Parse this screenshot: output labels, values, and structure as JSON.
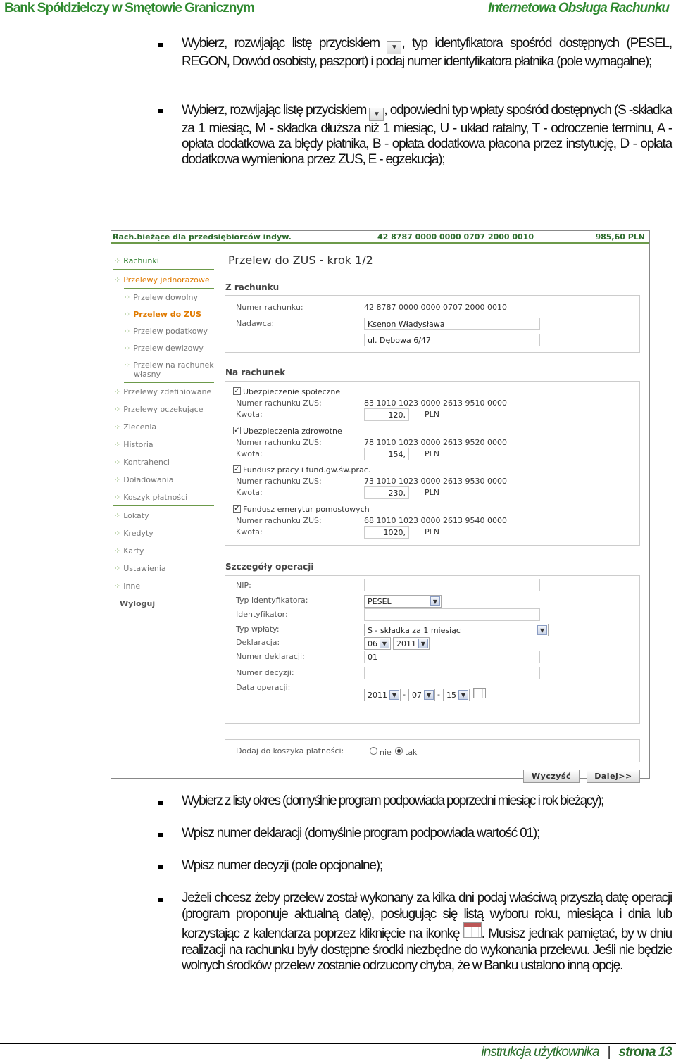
{
  "header": {
    "left": "Bank Spółdzielczy w Smętowie Granicznym",
    "right": "Internetowa Obsługa Rachunku"
  },
  "para1": {
    "a": "Wybierz, rozwijając listę przyciskiem",
    "b": ", typ identyfikatora spośród dostępnych (PESEL, REGON, Dowód osobisty, paszport) i podaj numer identyfikatora płatnika (pole wymagalne);"
  },
  "para2": {
    "a": "Wybierz, rozwijając listę przyciskiem",
    "b": ", odpowiedni typ wpłaty spośród dostępnych (S -składka za 1 miesiąc, M - składka dłuższa niż 1 miesiąc, U - układ ratalny, T - odroczenie terminu, A - opłata dodatkowa za błędy płatnika, B - opłata dodatkowa płacona przez instytucję, D - opłata dodatkowa wymieniona przez ZUS, E - egzekucja);"
  },
  "screen": {
    "topbar": {
      "account_name": "Rach.bieżące dla przedsiębiorców indyw.",
      "account_no": "42 8787 0000 0000 0707 2000 0010",
      "balance": "985,60 PLN"
    },
    "nav": {
      "rachunki": "Rachunki",
      "przelewy_jedn": "Przelewy jednorazowe",
      "dowolny": "Przelew dowolny",
      "zus": "Przelew do ZUS",
      "podatkowy": "Przelew podatkowy",
      "dewizowy": "Przelew dewizowy",
      "wlasny1": "Przelew na rachunek",
      "wlasny2": "własny",
      "zdefiniowane": "Przelewy zdefiniowane",
      "oczekujace": "Przelewy oczekujące",
      "zlecenia": "Zlecenia",
      "historia": "Historia",
      "kontrahenci": "Kontrahenci",
      "doladowania": "Doładowania",
      "koszyk": "Koszyk płatności",
      "lokaty": "Lokaty",
      "kredyty": "Kredyty",
      "karty": "Karty",
      "ustawienia": "Ustawienia",
      "inne": "Inne",
      "wyloguj": "Wyloguj"
    },
    "title": "Przelew do ZUS - krok 1/2",
    "from": {
      "section": "Z rachunku",
      "acc_label": "Numer rachunku:",
      "acc_value": "42 8787 0000 0000 0707 2000 0010",
      "sender_label": "Nadawca:",
      "sender_name": "Ksenon Władysława",
      "sender_addr": "ul. Dębowa 6/47"
    },
    "to": {
      "section": "Na rachunek",
      "acc_label": "Numer rachunku ZUS:",
      "amt_label": "Kwota:",
      "currency": "PLN",
      "items": [
        {
          "name": "Ubezpieczenie społeczne",
          "account": "83 1010 1023 0000 2613 9510 0000",
          "amount": "120,"
        },
        {
          "name": "Ubezpieczenia zdrowotne",
          "account": "78 1010 1023 0000 2613 9520 0000",
          "amount": "154,"
        },
        {
          "name": "Fundusz pracy i fund.gw.św.prac.",
          "account": "73 1010 1023 0000 2613 9530 0000",
          "amount": "230,"
        },
        {
          "name": "Fundusz emerytur pomostowych",
          "account": "68 1010 1023 0000 2613 9540 0000",
          "amount": "1020,"
        }
      ]
    },
    "details": {
      "section": "Szczegóły operacji",
      "nip": "NIP:",
      "id_type_label": "Typ identyfikatora:",
      "id_type": "PESEL",
      "id_label": "Identyfikator:",
      "pay_type_label": "Typ wpłaty:",
      "pay_type": "S - składka za 1 miesiąc",
      "decl_label": "Deklaracja:",
      "decl_month": "06",
      "decl_year": "2011",
      "decl_no_label": "Numer deklaracji:",
      "decl_no": "01",
      "decision_label": "Numer decyzji:",
      "date_label": "Data operacji:",
      "date_year": "2011",
      "date_month": "07",
      "date_day": "15",
      "dash": "-"
    },
    "basket": {
      "label": "Dodaj do koszyka płatności:",
      "no": "nie",
      "yes": "tak"
    },
    "buttons": {
      "clear": "Wyczyść",
      "next": "Dalej>>"
    }
  },
  "bullets": {
    "b1": "Wybierz z listy okres (domyślnie program podpowiada poprzedni miesiąc i rok bieżący);",
    "b2": "Wpisz numer deklaracji (domyślnie program podpowiada wartość 01);",
    "b3": "Wpisz numer decyzji (pole opcjonalne);",
    "b4a": "Jeżeli chcesz żeby przelew został wykonany za kilka dni podaj właściwą przyszłą datę operacji (program proponuje aktualną datę), posługując się listą wyboru roku, miesiąca i dnia lub korzystając z kalendarza poprzez kliknięcie na ikonkę",
    "b4b": ". Musisz jednak pamiętać, by w dniu realizacji na rachunku były dostępne środki niezbędne do wykonania przelewu. Jeśli nie będzie wolnych środków przelew zostanie odrzucony chyba, że w Banku ustalono inną opcję."
  },
  "footer": {
    "left": "instrukcja użytkownika",
    "sep": "|",
    "page": "strona 13"
  }
}
